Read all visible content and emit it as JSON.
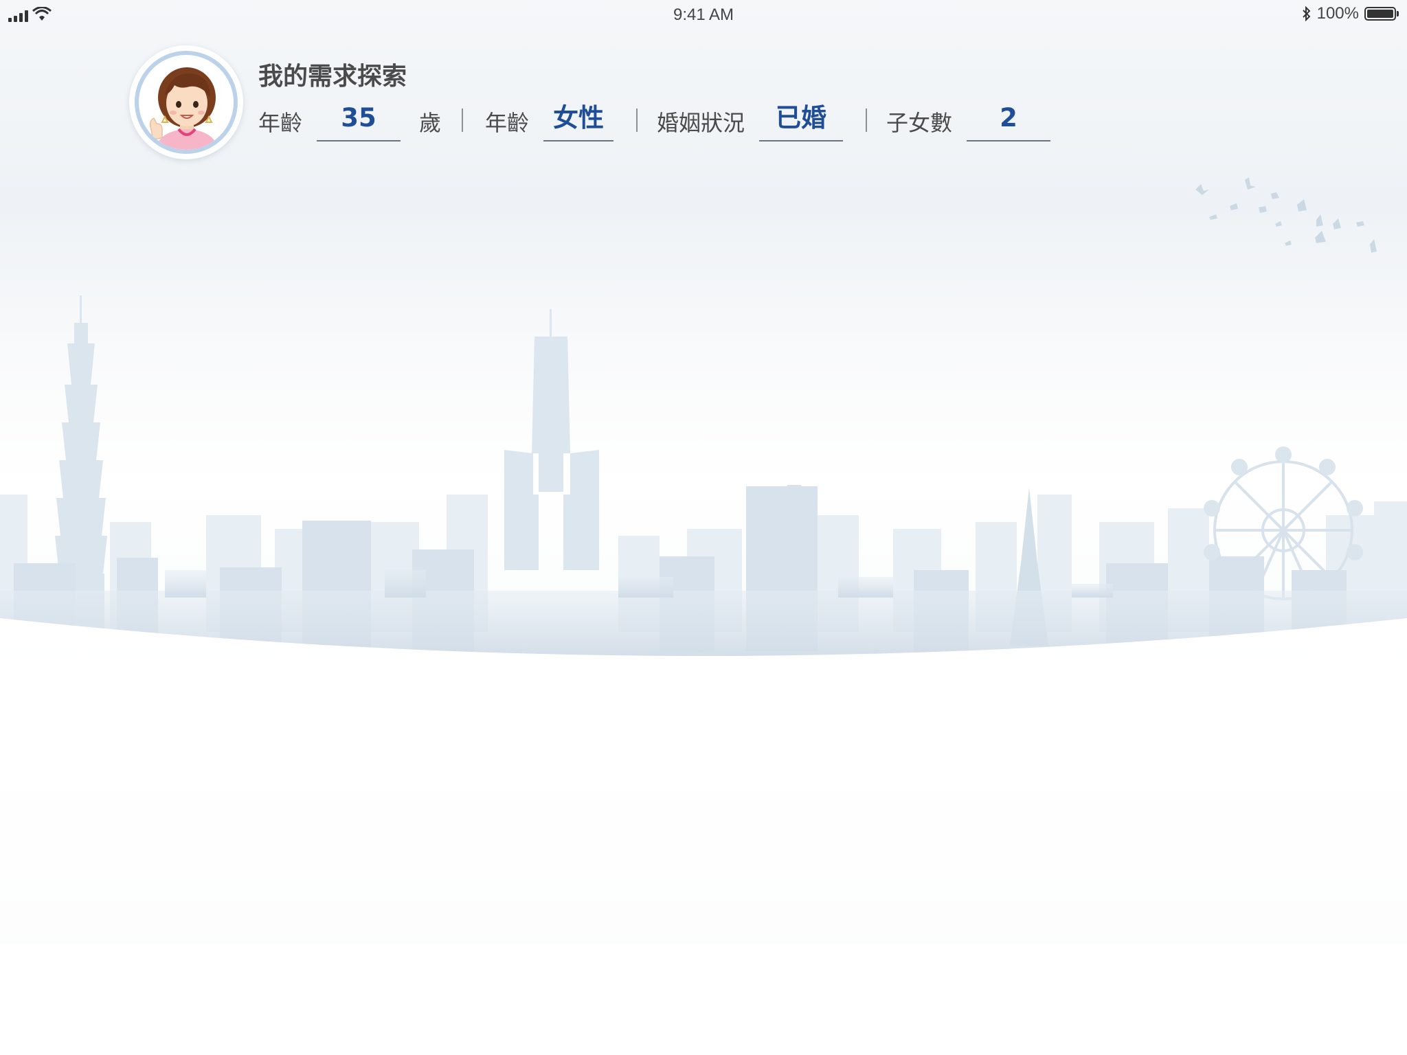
{
  "status_bar": {
    "time": "9:41 AM",
    "battery_text": "100%",
    "signal_icon": "cellular-signal-icon",
    "wifi_icon": "wifi-icon",
    "bluetooth_icon": "bluetooth-icon",
    "battery_icon": "battery-icon",
    "battery_level": 1.0
  },
  "profile": {
    "title": "我的需求探索",
    "avatar_icon": "female-avatar-icon",
    "fields": {
      "age_label": "年齡",
      "age_value": "35",
      "age_unit": "歲",
      "gender_label": "年齡",
      "gender_value": "女性",
      "marital_label": "婚姻狀況",
      "marital_value": "已婚",
      "children_label": "子女數",
      "children_value": "2"
    }
  },
  "colors": {
    "accent_value": "#1f4e96",
    "label_text": "#4a4a4a",
    "skyline": "#d9e4ee",
    "avatar_ring": "#bcd2ea"
  }
}
